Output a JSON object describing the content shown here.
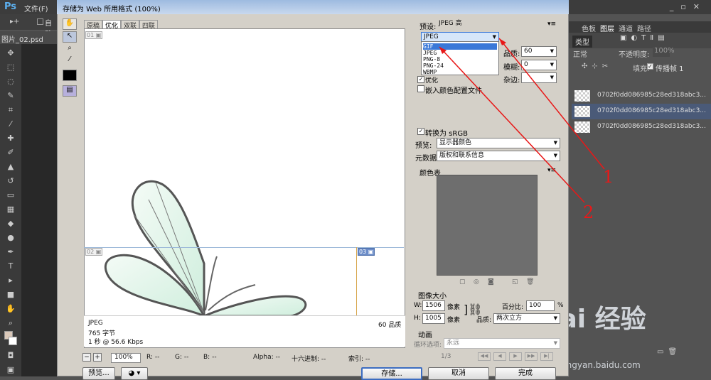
{
  "photoshop": {
    "logo": "Ps",
    "menu_file": "文件(F)",
    "options_partial": "自动",
    "doc_tab": "图片_02.psd",
    "panel_tabs": [
      "色板",
      "图层",
      "通道",
      "路径"
    ],
    "layers_kind": "类型",
    "blend_mode": "正常",
    "opacity_label": "不透明度:",
    "opacity_value": "100%",
    "fill_label": "填充:",
    "frame_label": "传播帧 1",
    "layers": [
      {
        "name": "0702f0dd086985c28ed318abc3..."
      },
      {
        "name": "0702f0dd086985c28ed318abc3..."
      },
      {
        "name": "0702f0dd086985c28ed318abc3..."
      }
    ]
  },
  "watermark": {
    "text": "Bai 经验",
    "url": "jingyan.baidu.com"
  },
  "dialog": {
    "title": "存储为 Web 所用格式 (100%)",
    "view_tabs": [
      "原稿",
      "优化",
      "双联",
      "四联"
    ],
    "info": {
      "format": "JPEG",
      "size": "765 字节",
      "speed": "1 秒 @ 56.6 Kbps",
      "quality": "60 品质"
    },
    "status": {
      "zoom": "100%",
      "r": "R: --",
      "g": "G: --",
      "b": "B: --",
      "alpha": "Alpha: --",
      "hex": "十六进制: --",
      "index": "索引: --"
    },
    "buttons": {
      "preview": "预览...",
      "save": "存储...",
      "cancel": "取消",
      "done": "完成"
    },
    "settings": {
      "preset_label": "预设:",
      "preset_value": "JPEG 高",
      "format_value": "JPEG",
      "format_options": [
        "GIF",
        "JPEG",
        "PNG-8",
        "PNG-24",
        "WBMP"
      ],
      "highlighted_option": "GIF",
      "quality_label": "品质:",
      "quality_value": "60",
      "blur_label": "模糊:",
      "blur_value": "0",
      "matte_label": "杂边:",
      "optimized_label": "优化",
      "embed_profile_label": "嵌入颜色配置文件",
      "convert_srgb_label": "转换为 sRGB",
      "preview_label": "预览:",
      "preview_value": "显示器颜色",
      "metadata_label": "元数据:",
      "metadata_value": "版权和联系信息",
      "color_table_label": "颜色表",
      "image_size_label": "图像大小",
      "width_label": "W:",
      "width_value": "1506",
      "height_label": "H:",
      "height_value": "1005",
      "pixels_unit": "像素",
      "percent_label": "百分比:",
      "percent_value": "100",
      "percent_unit": "%",
      "resample_label": "品质:",
      "resample_value": "两次立方",
      "animation_label": "动画",
      "loop_label": "循环选项:",
      "loop_value": "永远",
      "frame_counter": "1/3"
    }
  },
  "annotations": {
    "label_1": "1",
    "label_2": "2",
    "arrow_color": "#e81818"
  }
}
